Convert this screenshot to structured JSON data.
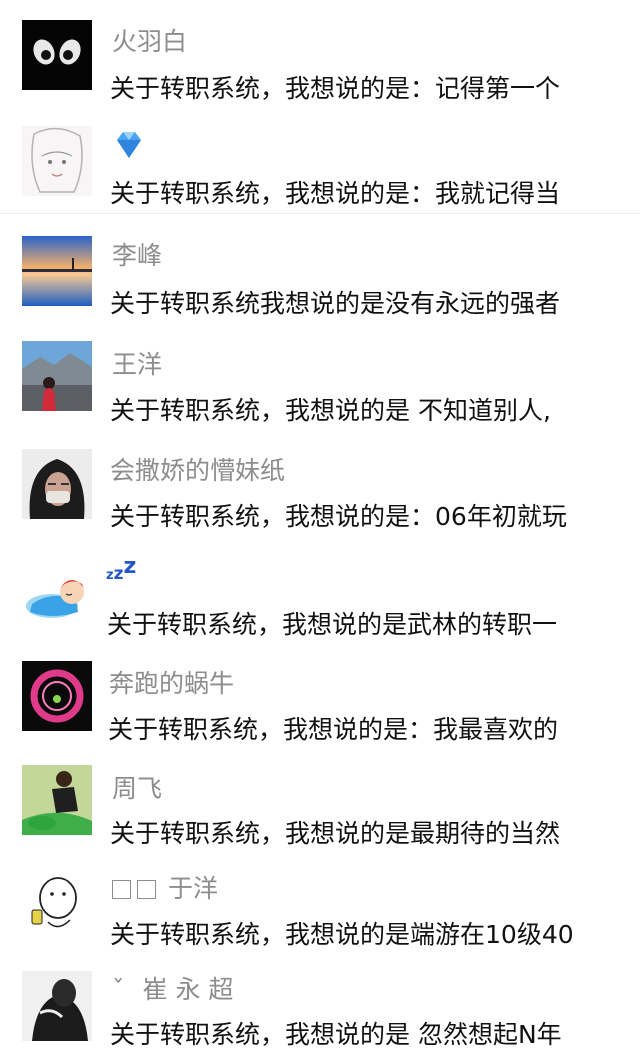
{
  "comments": [
    {
      "name": "火羽白",
      "message": "关于转职系统，我想说的是：记得第一个",
      "avatar_icon": "anime-eyes-avatar"
    },
    {
      "name": "",
      "name_icon": "diamond-icon",
      "message": "关于转职系统，我想说的是：我就记得当",
      "avatar_icon": "sketch-girl-avatar"
    },
    {
      "name": "李峰",
      "message": "关于转职系统我想说的是没有永远的强者",
      "avatar_icon": "lake-sunset-avatar"
    },
    {
      "name": "王洋",
      "message": "关于转职系统，我想说的是 不知道别人,",
      "avatar_icon": "mountain-person-avatar"
    },
    {
      "name": "会撒娇的懵妹纸",
      "message": "关于转职系统，我想说的是：06年初就玩",
      "avatar_icon": "hooded-girl-avatar"
    },
    {
      "name": "",
      "name_icon": "zzz-sleep-icon",
      "message": "关于转职系统，我想说的是武林的转职一",
      "avatar_icon": "sleeping-cartoon-avatar"
    },
    {
      "name": "奔跑的蜗牛",
      "message": "关于转职系统，我想说的是：我最喜欢的",
      "avatar_icon": "pink-ring-avatar"
    },
    {
      "name": "周飞",
      "message": "关于转职系统，我想说的是最期待的当然",
      "avatar_icon": "motorbike-avatar"
    },
    {
      "name": "于洋",
      "message": "关于转职系统，我想说的是端游在10级40",
      "avatar_icon": "doodle-drinking-avatar"
    },
    {
      "name": "崔 永 超",
      "name_prefix": "ˇ",
      "message": "关于转职系统，我想说的是 忽然想起N年",
      "avatar_icon": "bw-portrait-avatar"
    }
  ]
}
